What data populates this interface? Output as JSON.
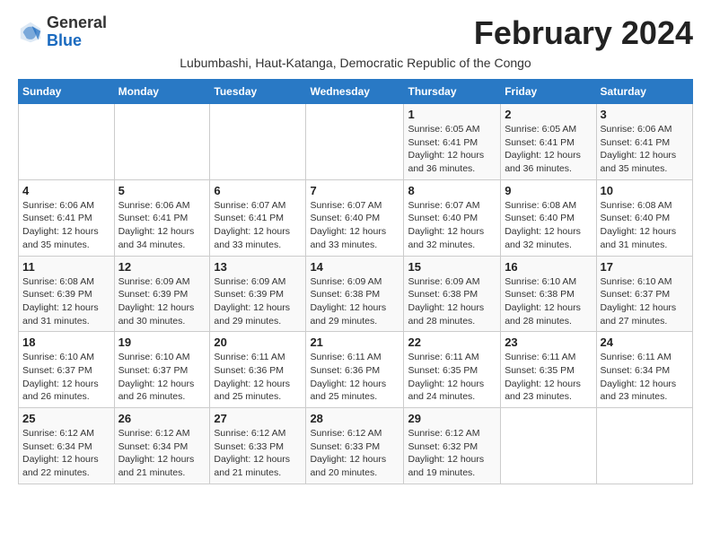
{
  "logo": {
    "general": "General",
    "blue": "Blue"
  },
  "month_title": "February 2024",
  "location": "Lubumbashi, Haut-Katanga, Democratic Republic of the Congo",
  "days_of_week": [
    "Sunday",
    "Monday",
    "Tuesday",
    "Wednesday",
    "Thursday",
    "Friday",
    "Saturday"
  ],
  "weeks": [
    [
      {
        "day": "",
        "info": ""
      },
      {
        "day": "",
        "info": ""
      },
      {
        "day": "",
        "info": ""
      },
      {
        "day": "",
        "info": ""
      },
      {
        "day": "1",
        "info": "Sunrise: 6:05 AM\nSunset: 6:41 PM\nDaylight: 12 hours and 36 minutes."
      },
      {
        "day": "2",
        "info": "Sunrise: 6:05 AM\nSunset: 6:41 PM\nDaylight: 12 hours and 36 minutes."
      },
      {
        "day": "3",
        "info": "Sunrise: 6:06 AM\nSunset: 6:41 PM\nDaylight: 12 hours and 35 minutes."
      }
    ],
    [
      {
        "day": "4",
        "info": "Sunrise: 6:06 AM\nSunset: 6:41 PM\nDaylight: 12 hours and 35 minutes."
      },
      {
        "day": "5",
        "info": "Sunrise: 6:06 AM\nSunset: 6:41 PM\nDaylight: 12 hours and 34 minutes."
      },
      {
        "day": "6",
        "info": "Sunrise: 6:07 AM\nSunset: 6:41 PM\nDaylight: 12 hours and 33 minutes."
      },
      {
        "day": "7",
        "info": "Sunrise: 6:07 AM\nSunset: 6:40 PM\nDaylight: 12 hours and 33 minutes."
      },
      {
        "day": "8",
        "info": "Sunrise: 6:07 AM\nSunset: 6:40 PM\nDaylight: 12 hours and 32 minutes."
      },
      {
        "day": "9",
        "info": "Sunrise: 6:08 AM\nSunset: 6:40 PM\nDaylight: 12 hours and 32 minutes."
      },
      {
        "day": "10",
        "info": "Sunrise: 6:08 AM\nSunset: 6:40 PM\nDaylight: 12 hours and 31 minutes."
      }
    ],
    [
      {
        "day": "11",
        "info": "Sunrise: 6:08 AM\nSunset: 6:39 PM\nDaylight: 12 hours and 31 minutes."
      },
      {
        "day": "12",
        "info": "Sunrise: 6:09 AM\nSunset: 6:39 PM\nDaylight: 12 hours and 30 minutes."
      },
      {
        "day": "13",
        "info": "Sunrise: 6:09 AM\nSunset: 6:39 PM\nDaylight: 12 hours and 29 minutes."
      },
      {
        "day": "14",
        "info": "Sunrise: 6:09 AM\nSunset: 6:38 PM\nDaylight: 12 hours and 29 minutes."
      },
      {
        "day": "15",
        "info": "Sunrise: 6:09 AM\nSunset: 6:38 PM\nDaylight: 12 hours and 28 minutes."
      },
      {
        "day": "16",
        "info": "Sunrise: 6:10 AM\nSunset: 6:38 PM\nDaylight: 12 hours and 28 minutes."
      },
      {
        "day": "17",
        "info": "Sunrise: 6:10 AM\nSunset: 6:37 PM\nDaylight: 12 hours and 27 minutes."
      }
    ],
    [
      {
        "day": "18",
        "info": "Sunrise: 6:10 AM\nSunset: 6:37 PM\nDaylight: 12 hours and 26 minutes."
      },
      {
        "day": "19",
        "info": "Sunrise: 6:10 AM\nSunset: 6:37 PM\nDaylight: 12 hours and 26 minutes."
      },
      {
        "day": "20",
        "info": "Sunrise: 6:11 AM\nSunset: 6:36 PM\nDaylight: 12 hours and 25 minutes."
      },
      {
        "day": "21",
        "info": "Sunrise: 6:11 AM\nSunset: 6:36 PM\nDaylight: 12 hours and 25 minutes."
      },
      {
        "day": "22",
        "info": "Sunrise: 6:11 AM\nSunset: 6:35 PM\nDaylight: 12 hours and 24 minutes."
      },
      {
        "day": "23",
        "info": "Sunrise: 6:11 AM\nSunset: 6:35 PM\nDaylight: 12 hours and 23 minutes."
      },
      {
        "day": "24",
        "info": "Sunrise: 6:11 AM\nSunset: 6:34 PM\nDaylight: 12 hours and 23 minutes."
      }
    ],
    [
      {
        "day": "25",
        "info": "Sunrise: 6:12 AM\nSunset: 6:34 PM\nDaylight: 12 hours and 22 minutes."
      },
      {
        "day": "26",
        "info": "Sunrise: 6:12 AM\nSunset: 6:34 PM\nDaylight: 12 hours and 21 minutes."
      },
      {
        "day": "27",
        "info": "Sunrise: 6:12 AM\nSunset: 6:33 PM\nDaylight: 12 hours and 21 minutes."
      },
      {
        "day": "28",
        "info": "Sunrise: 6:12 AM\nSunset: 6:33 PM\nDaylight: 12 hours and 20 minutes."
      },
      {
        "day": "29",
        "info": "Sunrise: 6:12 AM\nSunset: 6:32 PM\nDaylight: 12 hours and 19 minutes."
      },
      {
        "day": "",
        "info": ""
      },
      {
        "day": "",
        "info": ""
      }
    ]
  ]
}
